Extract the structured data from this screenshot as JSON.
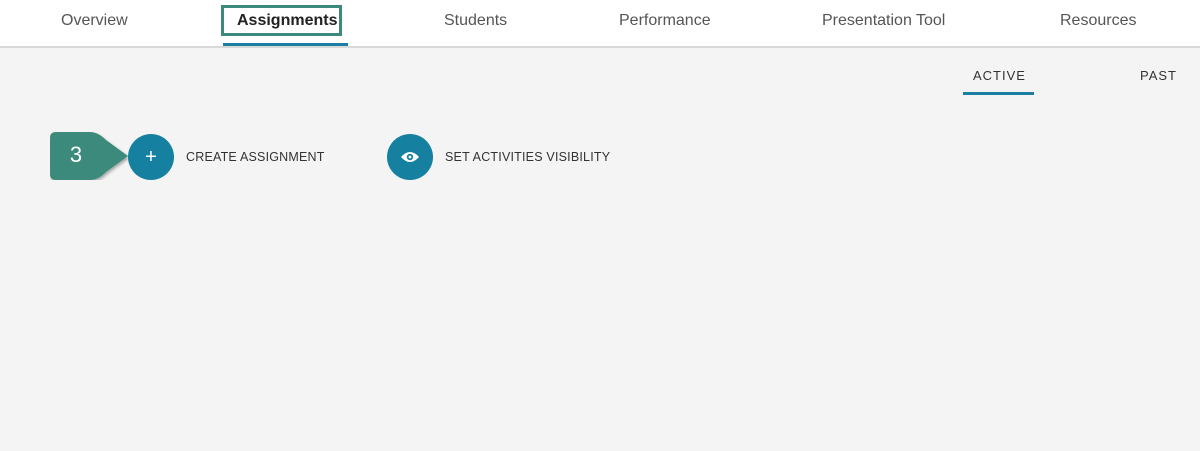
{
  "nav": {
    "tabs": [
      {
        "label": "Overview"
      },
      {
        "label": "Assignments"
      },
      {
        "label": "Students"
      },
      {
        "label": "Performance"
      },
      {
        "label": "Presentation Tool"
      },
      {
        "label": "Resources"
      }
    ],
    "active_tab": "Assignments"
  },
  "subtabs": {
    "items": [
      {
        "label": "ACTIVE"
      },
      {
        "label": "PAST"
      }
    ],
    "active": "ACTIVE"
  },
  "actions": {
    "create": {
      "icon": "plus-icon",
      "symbol": "+",
      "label": "CREATE ASSIGNMENT"
    },
    "visibility": {
      "icon": "eye-icon",
      "label": "SET ACTIVITIES VISIBILITY"
    }
  },
  "callout": {
    "number": "3",
    "color": "#3b8a7c"
  },
  "colors": {
    "accent": "#15809f",
    "highlight": "#3b8a7c",
    "content_bg": "#f4f4f4"
  }
}
